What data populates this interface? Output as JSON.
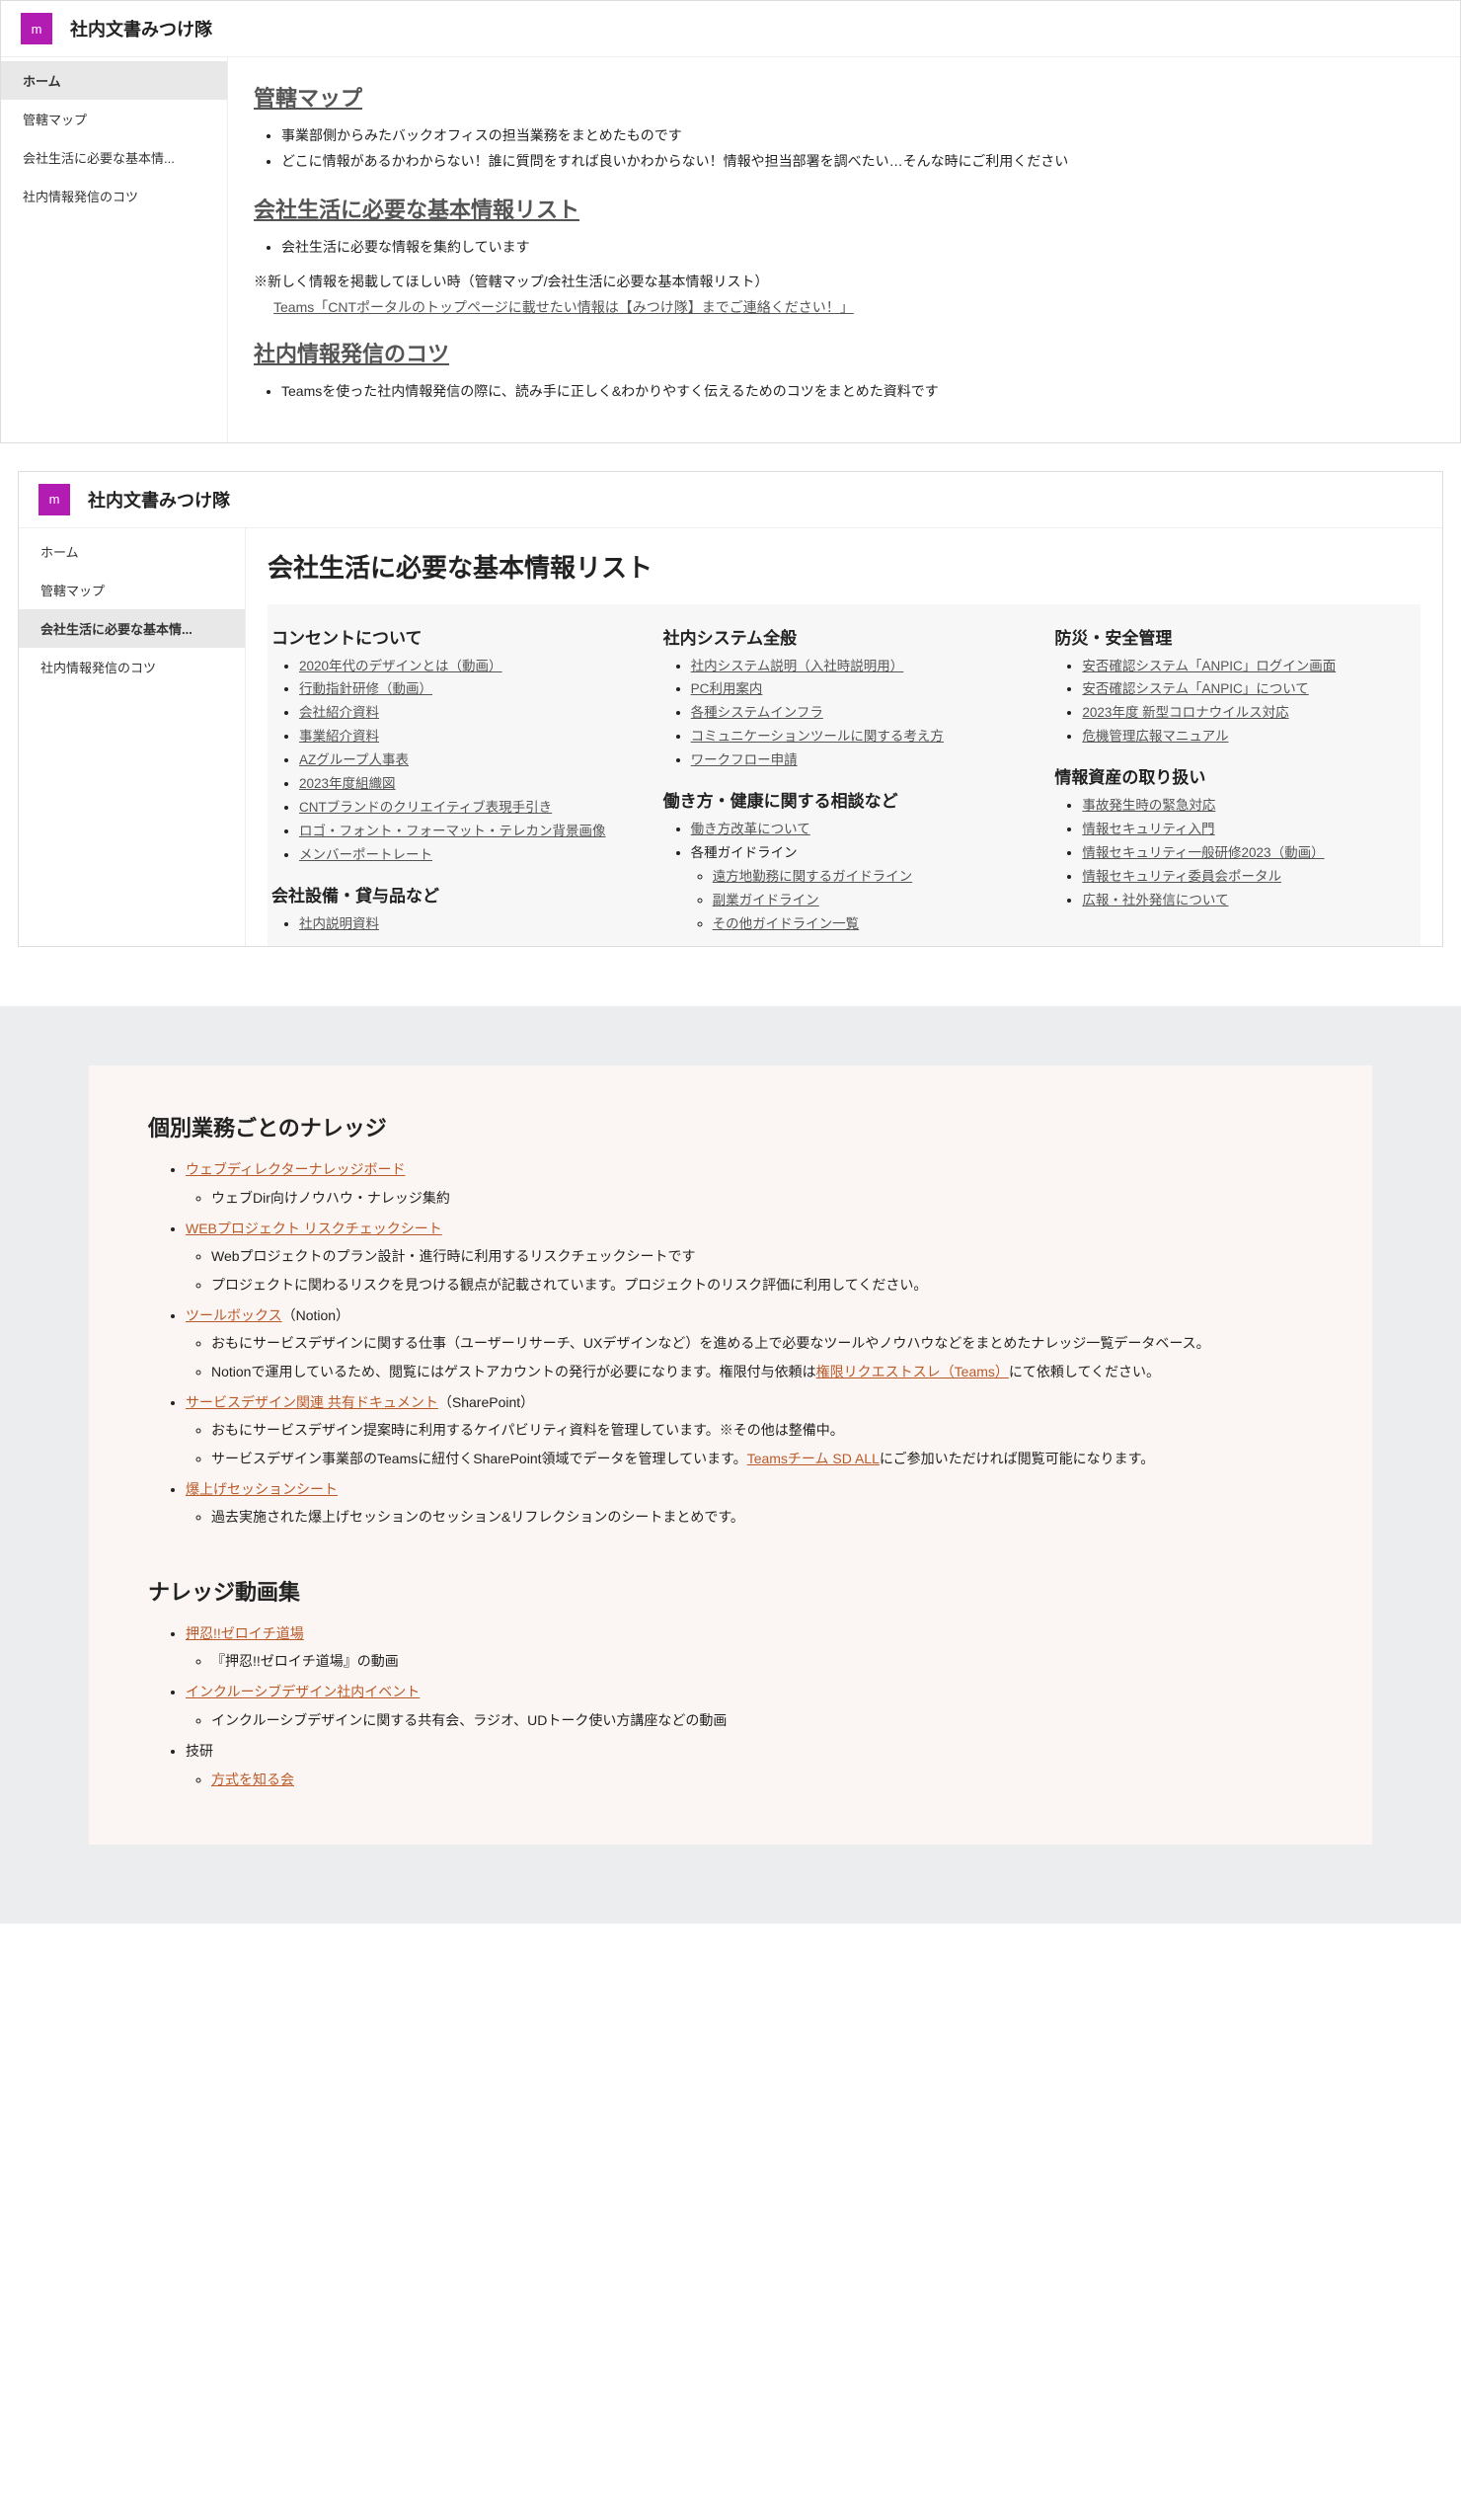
{
  "site": {
    "logo_letter": "m",
    "title": "社内文書みつけ隊"
  },
  "nav": {
    "items": [
      {
        "label": "ホーム"
      },
      {
        "label": "管轄マップ"
      },
      {
        "label": "会社生活に必要な基本情..."
      },
      {
        "label": "社内情報発信のコツ"
      }
    ]
  },
  "panel1": {
    "sections": [
      {
        "heading": "管轄マップ",
        "bullets": [
          "事業部側からみたバックオフィスの担当業務をまとめたものです",
          "どこに情報があるかわからない！誰に質問をすれば良いかわからない！情報や担当部署を調べたい…そんな時にご利用ください"
        ]
      },
      {
        "heading": "会社生活に必要な基本情報リスト",
        "bullets": [
          "会社生活に必要な情報を集約しています"
        ]
      },
      {
        "note": "※新しく情報を掲載してほしい時（管轄マップ/会社生活に必要な基本情報リスト）",
        "note_link": "Teams「CNTポータルのトップページに載せたい情報は【みつけ隊】までご連絡ください！」"
      },
      {
        "heading": "社内情報発信のコツ",
        "bullets": [
          "Teamsを使った社内情報発信の際に、読み手に正しく&わかりやすく伝えるためのコツをまとめた資料です"
        ]
      }
    ]
  },
  "panel2": {
    "page_title": "会社生活に必要な基本情報リスト",
    "col1": [
      {
        "heading": "コンセントについて",
        "links": [
          "2020年代のデザインとは（動画）",
          "行動指針研修（動画）",
          "会社紹介資料",
          "事業紹介資料",
          "AZグループ人事表",
          "2023年度組織図",
          "CNTブランドのクリエイティブ表現手引き",
          "ロゴ・フォント・フォーマット・テレカン背景画像",
          "メンバーポートレート"
        ]
      },
      {
        "heading": "会社設備・貸与品など",
        "links": [
          "社内説明資料"
        ]
      }
    ],
    "col2": [
      {
        "heading": "社内システム全般",
        "links": [
          "社内システム説明（入社時説明用）",
          "PC利用案内",
          "各種システムインフラ",
          "コミュニケーションツールに関する考え方",
          "ワークフロー申請"
        ]
      },
      {
        "heading": "働き方・健康に関する相談など",
        "links_mixed": [
          {
            "text": "働き方改革について",
            "link": true
          },
          {
            "text": "各種ガイドライン",
            "link": false,
            "sub": [
              "遠方地勤務に関するガイドライン",
              "副業ガイドライン",
              "その他ガイドライン一覧"
            ]
          }
        ]
      }
    ],
    "col3": [
      {
        "heading": "防災・安全管理",
        "links": [
          "安否確認システム「ANPIC」ログイン画面",
          "安否確認システム「ANPIC」について",
          "2023年度 新型コロナウイルス対応",
          "危機管理広報マニュアル"
        ]
      },
      {
        "heading": "情報資産の取り扱い",
        "links": [
          "事故発生時の緊急対応",
          "情報セキュリティ入門",
          "情報セキュリティ一般研修2023（動画）",
          "情報セキュリティ委員会ポータル",
          "広報・社外発信について"
        ]
      }
    ]
  },
  "knowledge": {
    "heading1": "個別業務ごとのナレッジ",
    "items1": [
      {
        "link": "ウェブディレクターナレッジボード",
        "subs": [
          "ウェブDir向けノウハウ・ナレッジ集約"
        ]
      },
      {
        "link": "WEBプロジェクト リスクチェックシート",
        "subs": [
          "Webプロジェクトのプラン設計・進行時に利用するリスクチェックシートです",
          "プロジェクトに関わるリスクを見つける観点が記載されています。プロジェクトのリスク評価に利用してください。"
        ]
      },
      {
        "link": "ツールボックス",
        "suffix": "（Notion）",
        "subs": [
          "おもにサービスデザインに関する仕事（ユーザーリサーチ、UXデザインなど）を進める上で必要なツールやノウハウなどをまとめたナレッジ一覧データベース。",
          {
            "pre": "Notionで運用しているため、閲覧にはゲストアカウントの発行が必要になります。権限付与依頼は",
            "link": "権限リクエストスレ（Teams）",
            "post": "にて依頼してください。"
          }
        ]
      },
      {
        "link": "サービスデザイン関連 共有ドキュメント",
        "suffix": "（SharePoint）",
        "subs": [
          "おもにサービスデザイン提案時に利用するケイパビリティ資料を管理しています。※その他は整備中。",
          {
            "pre": "サービスデザイン事業部のTeamsに紐付くSharePoint領域でデータを管理しています。",
            "link": "Teamsチーム SD ALL",
            "post": "にご参加いただければ閲覧可能になります。"
          }
        ]
      },
      {
        "link": "爆上げセッションシート",
        "subs": [
          "過去実施された爆上げセッションのセッション&リフレクションのシートまとめです。"
        ]
      }
    ],
    "heading2": "ナレッジ動画集",
    "items2": [
      {
        "link": "押忍!!ゼロイチ道場",
        "subs": [
          "『押忍!!ゼロイチ道場』の動画"
        ]
      },
      {
        "link": "インクルーシブデザイン社内イベント",
        "subs": [
          "インクルーシブデザインに関する共有会、ラジオ、UDトーク使い方講座などの動画"
        ]
      },
      {
        "plain": "技研",
        "subs_link": [
          "方式を知る会"
        ]
      }
    ]
  }
}
